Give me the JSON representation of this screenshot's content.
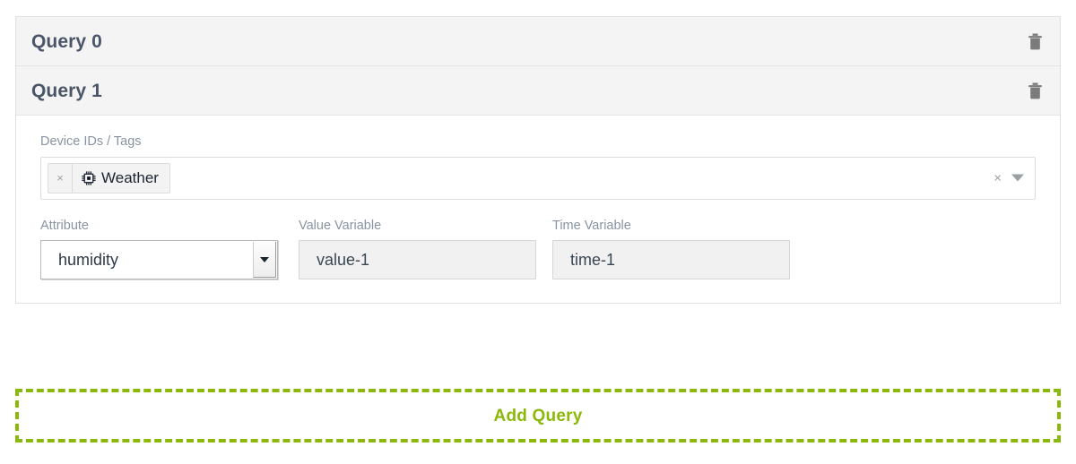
{
  "theme": {
    "accent_green": "#8cb80b",
    "title_color": "#4a5568",
    "label_color": "#8a94a0",
    "header_bg": "#f4f4f4",
    "input_bg": "#f1f1f1"
  },
  "queries": [
    {
      "title": "Query 0",
      "delete_icon": "trash-icon",
      "expanded": false
    },
    {
      "title": "Query 1",
      "delete_icon": "trash-icon",
      "expanded": true,
      "fields": {
        "device_tags": {
          "label": "Device IDs / Tags",
          "chips": [
            {
              "remove_label": "×",
              "icon": "microchip-icon",
              "label": "Weather"
            }
          ],
          "clear_label": "×",
          "caret_icon": "chevron-down-icon"
        },
        "attribute": {
          "label": "Attribute",
          "value": "humidity",
          "caret_icon": "chevron-down-icon"
        },
        "value_variable": {
          "label": "Value Variable",
          "value": "value-1",
          "placeholder": "value-1"
        },
        "time_variable": {
          "label": "Time Variable",
          "value": "time-1",
          "placeholder": "time-1"
        }
      }
    }
  ],
  "add_query": {
    "label": "Add Query"
  }
}
